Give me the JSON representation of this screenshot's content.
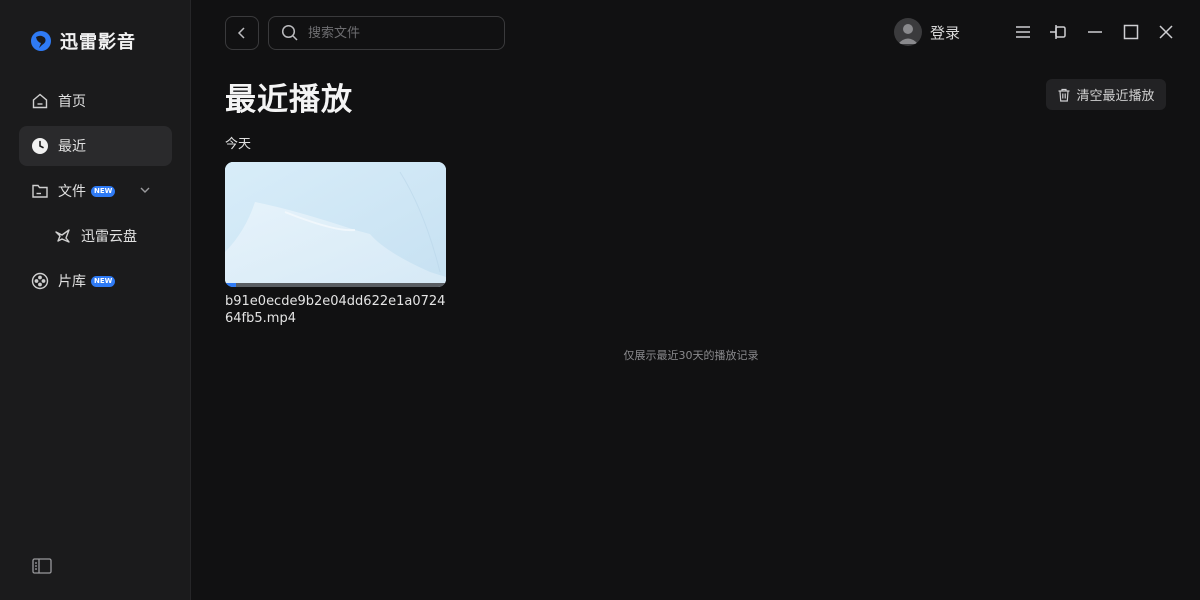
{
  "app": {
    "name": "迅雷影音"
  },
  "sidebar": {
    "items": [
      {
        "label": "首页",
        "icon": "home-icon"
      },
      {
        "label": "最近",
        "icon": "clock-icon",
        "active": true
      },
      {
        "label": "文件",
        "icon": "folder-icon",
        "badge": "NEW",
        "expandable": true
      },
      {
        "label": "迅雷云盘",
        "icon": "cloud-bird-icon",
        "sub": true
      },
      {
        "label": "片库",
        "icon": "film-reel-icon",
        "badge": "NEW"
      }
    ]
  },
  "topbar": {
    "search_placeholder": "搜索文件",
    "login_label": "登录"
  },
  "main": {
    "title": "最近播放",
    "clear_label": "清空最近播放",
    "section": "今天",
    "videos": [
      {
        "filename": "b91e0ecde9b2e04dd622e1a072464fb5.mp4",
        "progress": 0.05
      }
    ],
    "footnote": "仅展示最近30天的播放记录"
  },
  "colors": {
    "accent": "#2f7bf5",
    "background": "#111112",
    "sidebar": "#1b1b1c"
  }
}
